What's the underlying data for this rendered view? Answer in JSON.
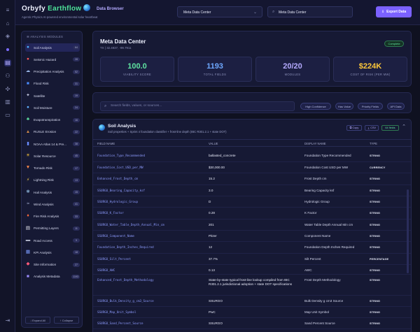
{
  "header": {
    "logo_left": "Orbyfy ",
    "logo_right": "Earthflow",
    "page_title": "Data Browser",
    "tagline": "Agentic Physics AI-powered environmental solar heartbeat",
    "dataset_select": "Meta Data Center",
    "search_value": "Meta Data Center",
    "export_label": "Export Data"
  },
  "sidebar": {
    "heading": "ANALYSIS MODULES",
    "items": [
      {
        "label": "Soil Analysis",
        "count": "64",
        "icon": "globe-icon",
        "glyph": "●",
        "color": "#4ab3ff"
      },
      {
        "label": "Seismic Hazard",
        "count": "28",
        "icon": "seismic-icon",
        "glyph": "●",
        "color": "#ff5a5a"
      },
      {
        "label": "Precipitation Analysis",
        "count": "52",
        "icon": "rain-cloud-icon",
        "glyph": "☁",
        "color": "#9ab8e8"
      },
      {
        "label": "Flood Risk",
        "count": "31",
        "icon": "flood-icon",
        "glyph": "■",
        "color": "#4a8cff"
      },
      {
        "label": "Satellite",
        "count": "19",
        "icon": "satellite-icon",
        "glyph": "✦",
        "color": "#c9cde6"
      },
      {
        "label": "Soil Moisture",
        "count": "24",
        "icon": "droplet-icon",
        "glyph": "●",
        "color": "#5fb0ff"
      },
      {
        "label": "Evapotranspiration",
        "count": "16",
        "icon": "leaf-icon",
        "glyph": "♣",
        "color": "#5fe3a1"
      },
      {
        "label": "RUSLE Erosion",
        "count": "22",
        "icon": "erosion-icon",
        "glyph": "▲",
        "color": "#d08a4a"
      },
      {
        "label": "NOAA Atlas 14 & Pre...",
        "count": "38",
        "icon": "chart-icon",
        "glyph": "▮",
        "color": "#6a8cff"
      },
      {
        "label": "Solar Resource",
        "count": "45",
        "icon": "sun-icon",
        "glyph": "☀",
        "color": "#ffc83a"
      },
      {
        "label": "Tornado Risk",
        "count": "17",
        "icon": "tornado-icon",
        "glyph": "▼",
        "color": "#ff8a4a"
      },
      {
        "label": "Lightning Risk",
        "count": "13",
        "icon": "lightning-icon",
        "glyph": "⚡",
        "color": "#ffd84a"
      },
      {
        "label": "Hail Analysis",
        "count": "15",
        "icon": "hail-icon",
        "glyph": "❄",
        "color": "#a8d8ff"
      },
      {
        "label": "Wind Analysis",
        "count": "41",
        "icon": "wind-icon",
        "glyph": "≈",
        "color": "#b8c4e8"
      },
      {
        "label": "Fire Risk Analysis",
        "count": "33",
        "icon": "fire-icon",
        "glyph": "♦",
        "color": "#ff6a3a"
      },
      {
        "label": "Permitting Layers",
        "count": "11",
        "icon": "document-icon",
        "glyph": "▤",
        "color": "#e8e8f0"
      },
      {
        "label": "Road Access",
        "count": "9",
        "icon": "road-icon",
        "glyph": "▬",
        "color": "#b0b4c8"
      },
      {
        "label": "KPI Analysis",
        "count": "18",
        "icon": "kpi-chart-icon",
        "glyph": "▦",
        "color": "#7b9cff"
      },
      {
        "label": "Site Information",
        "count": "27",
        "icon": "pin-icon",
        "glyph": "◆",
        "color": "#ff5a7a"
      },
      {
        "label": "Analysis Metadata",
        "count": "1193",
        "icon": "metadata-icon",
        "glyph": "■",
        "color": "#9b8cff"
      }
    ],
    "expand_label": "↓ Expand All",
    "collapse_label": "↑ Collapse"
  },
  "overview": {
    "title": "Meta Data Center",
    "coords": "TX | 32.4937, -99.7911",
    "status": "Complete",
    "stats": [
      {
        "value": "100.0",
        "label": "VIABILITY SCORE",
        "color": "#5fe3a1"
      },
      {
        "value": "1193",
        "label": "TOTAL FIELDS",
        "color": "#6ea8ff"
      },
      {
        "value": "20/20",
        "label": "MODULES",
        "color": "#b4aaff"
      },
      {
        "value": "$224K",
        "label": "COST OF RISK (PER MW)",
        "color": "#ffc83a"
      }
    ]
  },
  "search": {
    "placeholder": "Search fields, values, or sources...",
    "filters": [
      "High Confidence",
      "Has Value",
      "Priority Fields",
      "API Data"
    ]
  },
  "section": {
    "title": "Soil Analysis",
    "subtitle": "Soil properties + Sprint 4 foundation classifier + frost-line depth (IBC R301.2.1 + state DOT)",
    "copy_label": "Copy",
    "csv_label": "CSV",
    "fields_badge": "64 fields",
    "columns": {
      "field": "FIELD NAME",
      "value": "VALUE",
      "display": "DISPLAY NAME",
      "type": "TYPE"
    },
    "rows": [
      {
        "field": "Foundation_Type_Recommended",
        "value": "ballasted_concrete",
        "display": "Foundation Type Recommended",
        "type": "STRING"
      },
      {
        "field": "Foundation_Cost_USD_per_MW",
        "value": "$30,000.00",
        "display": "Foundation Cost USD per MW",
        "type": "CURRENCY"
      },
      {
        "field": "Enhanced_Frost_Depth_cm",
        "value": "15.2",
        "display": "Frost Depth cm",
        "type": "STRING"
      },
      {
        "field": "SSURGO_Bearing_Capacity_ksf",
        "value": "3.0",
        "display": "Bearing Capacity ksf",
        "type": "STRING"
      },
      {
        "field": "SSURGO_Hydrologic_Group",
        "value": "D",
        "display": "Hydrologic Group",
        "type": "STRING"
      },
      {
        "field": "SSURGO_K_Factor",
        "value": "0.28",
        "display": "K Factor",
        "type": "STRING"
      },
      {
        "field": "SSURGO_Water_Table_Depth_Annual_Min_cm",
        "value": "201",
        "display": "Water Table Depth Annual Min cm",
        "type": "STRING"
      },
      {
        "field": "SSURGO_Component_Name",
        "value": "Pitzer",
        "display": "Component Name",
        "type": "STRING"
      },
      {
        "field": "Foundation_Depth_Inches_Required",
        "value": "12",
        "display": "Foundation Depth Inches Required",
        "type": "STRING"
      },
      {
        "field": "SSURGO_Silt_Percent",
        "value": "37.7%",
        "display": "Silt Percent",
        "type": "PERCENTAGE"
      },
      {
        "field": "SSURGO_AWC",
        "value": "0.13",
        "display": "AWC",
        "type": "STRING"
      },
      {
        "field": "Enhanced_Frost_Depth_Methodology",
        "value": "State-by-state typical frost-line lookup compiled from IBC R301.2.1 jurisdictional adoption + state DOT specifications",
        "display": "Frost Depth Methodology",
        "type": "STRING"
      },
      {
        "field": "SSURGO_Bulk_Density_g_cm3_Source",
        "value": "SSURGO",
        "display": "Bulk Density g cm3 Source",
        "type": "STRING"
      },
      {
        "field": "SSURGO_Map_Unit_Symbol",
        "value": "PwC",
        "display": "Map Unit Symbol",
        "type": "STRING"
      },
      {
        "field": "SSURGO_Sand_Percent_Source",
        "value": "SSURGO",
        "display": "Sand Percent Source",
        "type": "STRING"
      },
      {
        "field": "SSURGO_Map_Unit_Name",
        "value": "Pitzer-Weymouth complex 1 to 5 percent slopes",
        "display": "Map Unit Name",
        "type": "STRING"
      }
    ]
  }
}
